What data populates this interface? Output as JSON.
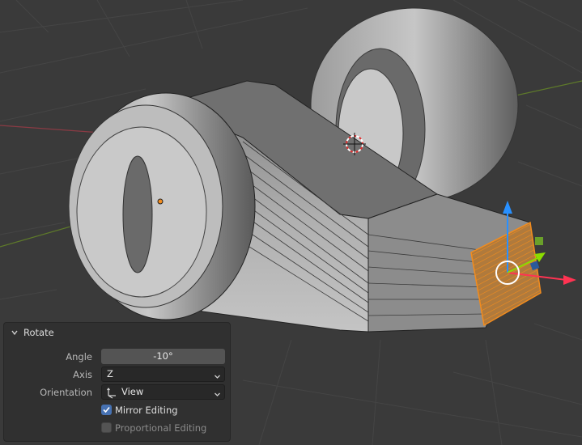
{
  "viewport": {
    "icons": [
      "3d-cursor-icon",
      "origin-point-icon",
      "rotate-gizmo-icon"
    ],
    "colors": {
      "background": "#3a3a3a",
      "mesh": "#a8a8a8",
      "selection": "#f28c1e",
      "x_axis": "#ff3352",
      "y_axis": "#8bdc00",
      "z_axis": "#2890ff"
    }
  },
  "operator_panel": {
    "title": "Rotate",
    "angle": {
      "label": "Angle",
      "value": "-10°"
    },
    "axis": {
      "label": "Axis",
      "value": "Z"
    },
    "orientation": {
      "label": "Orientation",
      "value": "View"
    },
    "mirror_editing": {
      "label": "Mirror Editing",
      "checked": true
    },
    "proportional_editing": {
      "label": "Proportional Editing",
      "checked": false,
      "enabled": false
    }
  }
}
